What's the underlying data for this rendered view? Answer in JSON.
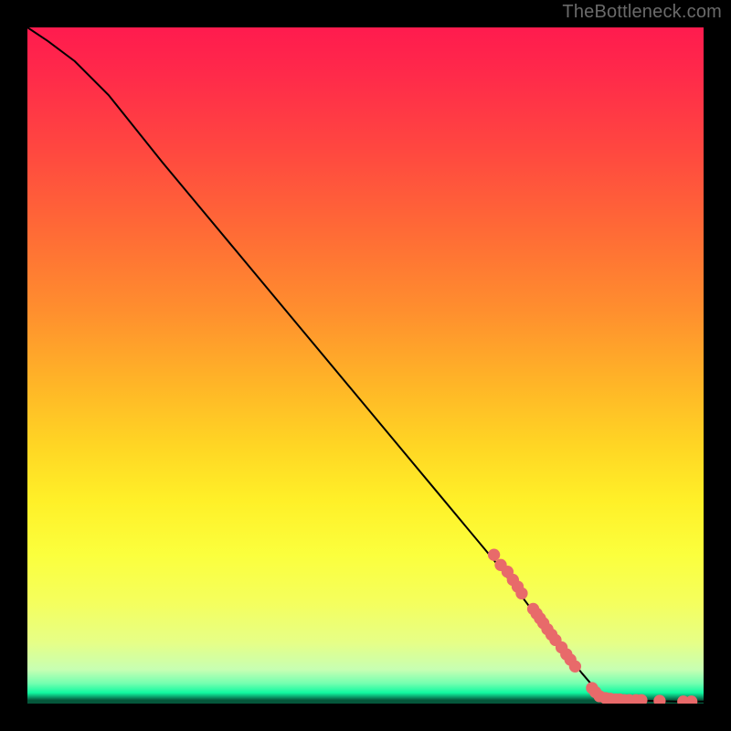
{
  "watermark": "TheBottleneck.com",
  "chart_data": {
    "type": "line",
    "title": "",
    "xlabel": "",
    "ylabel": "",
    "xlim": [
      0,
      100
    ],
    "ylim": [
      0,
      100
    ],
    "grid": false,
    "legend": false,
    "series": [
      {
        "name": "curve",
        "type": "line",
        "color": "#000000",
        "points": [
          {
            "x": 0.0,
            "y": 100.0
          },
          {
            "x": 3.0,
            "y": 98.0
          },
          {
            "x": 7.0,
            "y": 95.0
          },
          {
            "x": 12.0,
            "y": 90.0
          },
          {
            "x": 20.0,
            "y": 80.0
          },
          {
            "x": 30.0,
            "y": 68.0
          },
          {
            "x": 40.0,
            "y": 56.0
          },
          {
            "x": 50.0,
            "y": 44.0
          },
          {
            "x": 60.0,
            "y": 32.0
          },
          {
            "x": 70.0,
            "y": 20.0
          },
          {
            "x": 76.0,
            "y": 12.0
          },
          {
            "x": 82.0,
            "y": 4.5
          },
          {
            "x": 85.0,
            "y": 1.0
          },
          {
            "x": 88.0,
            "y": 0.5
          },
          {
            "x": 92.0,
            "y": 0.4
          },
          {
            "x": 96.0,
            "y": 0.3
          },
          {
            "x": 100.0,
            "y": 0.3
          }
        ]
      },
      {
        "name": "markers",
        "type": "scatter",
        "color": "#e86a6a",
        "points": [
          {
            "x": 69.0,
            "y": 22.0
          },
          {
            "x": 70.0,
            "y": 20.5
          },
          {
            "x": 71.0,
            "y": 19.5
          },
          {
            "x": 71.8,
            "y": 18.3
          },
          {
            "x": 72.5,
            "y": 17.3
          },
          {
            "x": 73.1,
            "y": 16.3
          },
          {
            "x": 74.8,
            "y": 14.0
          },
          {
            "x": 75.3,
            "y": 13.3
          },
          {
            "x": 75.8,
            "y": 12.6
          },
          {
            "x": 76.3,
            "y": 11.9
          },
          {
            "x": 76.9,
            "y": 11.0
          },
          {
            "x": 77.5,
            "y": 10.2
          },
          {
            "x": 78.1,
            "y": 9.4
          },
          {
            "x": 79.0,
            "y": 8.3
          },
          {
            "x": 79.7,
            "y": 7.3
          },
          {
            "x": 80.3,
            "y": 6.5
          },
          {
            "x": 81.0,
            "y": 5.5
          },
          {
            "x": 83.5,
            "y": 2.3
          },
          {
            "x": 84.0,
            "y": 1.7
          },
          {
            "x": 84.6,
            "y": 1.1
          },
          {
            "x": 85.5,
            "y": 0.8
          },
          {
            "x": 86.2,
            "y": 0.7
          },
          {
            "x": 87.0,
            "y": 0.6
          },
          {
            "x": 87.6,
            "y": 0.6
          },
          {
            "x": 88.3,
            "y": 0.5
          },
          {
            "x": 89.0,
            "y": 0.5
          },
          {
            "x": 90.0,
            "y": 0.5
          },
          {
            "x": 90.8,
            "y": 0.5
          },
          {
            "x": 93.5,
            "y": 0.4
          },
          {
            "x": 97.0,
            "y": 0.3
          },
          {
            "x": 98.2,
            "y": 0.3
          }
        ]
      }
    ]
  }
}
